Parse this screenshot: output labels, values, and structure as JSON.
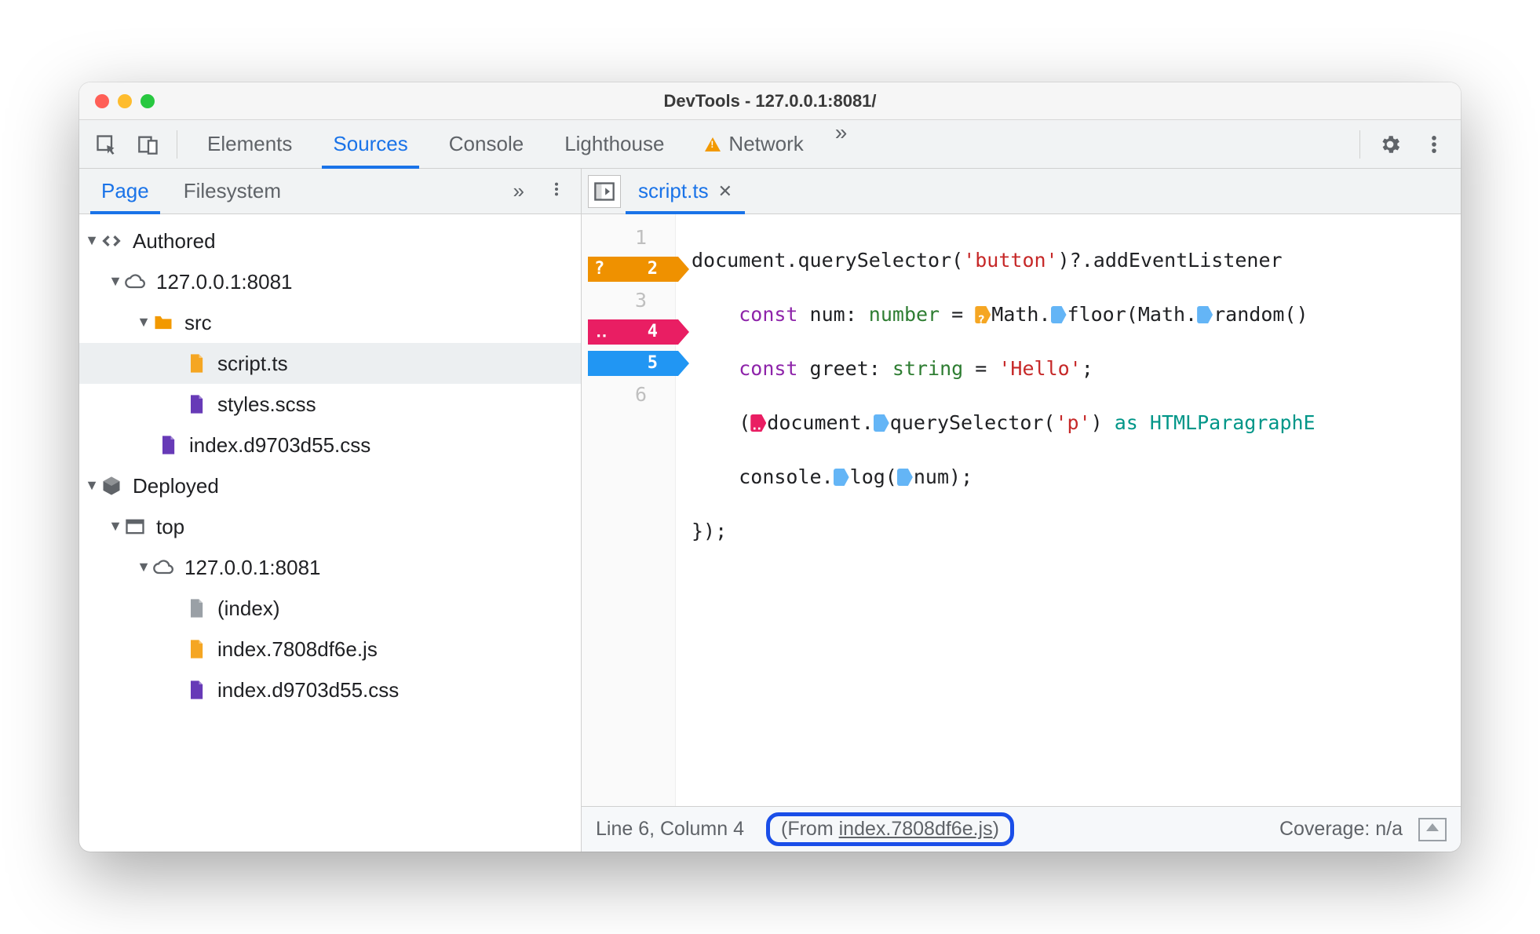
{
  "window": {
    "title": "DevTools - 127.0.0.1:8081/"
  },
  "mainTabs": {
    "elements": "Elements",
    "sources": "Sources",
    "console": "Console",
    "lighthouse": "Lighthouse",
    "network": "Network",
    "more": "»"
  },
  "sideTabs": {
    "page": "Page",
    "filesystem": "Filesystem",
    "more": "»"
  },
  "tree": {
    "authored": "Authored",
    "host1": "127.0.0.1:8081",
    "src": "src",
    "script": "script.ts",
    "styles": "styles.scss",
    "indexcss": "index.d9703d55.css",
    "deployed": "Deployed",
    "top": "top",
    "host2": "127.0.0.1:8081",
    "index": "(index)",
    "indexjs": "index.7808df6e.js",
    "indexcss2": "index.d9703d55.css"
  },
  "editor": {
    "tab": "script.ts",
    "gutters": {
      "l1": "1",
      "l2": "2",
      "l3": "3",
      "l4": "4",
      "l5": "5",
      "l6": "6"
    },
    "code": {
      "l1a": "document.querySelector(",
      "l1b": "'button'",
      "l1c": ")?.addEventListener",
      "l2a": "const ",
      "l2b": "num",
      "l2c": ": ",
      "l2d": "number",
      "l2e": " = ",
      "l2f": "Math.",
      "l2g": "floor(Math.",
      "l2h": "random()",
      "l3a": "const ",
      "l3b": "greet",
      "l3c": ": ",
      "l3d": "string",
      "l3e": " = ",
      "l3f": "'Hello'",
      "l3g": ";",
      "l4a": "(",
      "l4b": "document.",
      "l4c": "querySelector(",
      "l4d": "'p'",
      "l4e": ") ",
      "l4f": "as ",
      "l4g": "HTMLParagraphE",
      "l5a": "console.",
      "l5b": "log(",
      "l5c": "num);",
      "l6a": "});"
    }
  },
  "status": {
    "pos": "Line 6, Column 4",
    "fromPrefix": "(From ",
    "fromLink": "index.7808df6e.js",
    "fromSuffix": ")",
    "coverage": "Coverage: n/a"
  }
}
